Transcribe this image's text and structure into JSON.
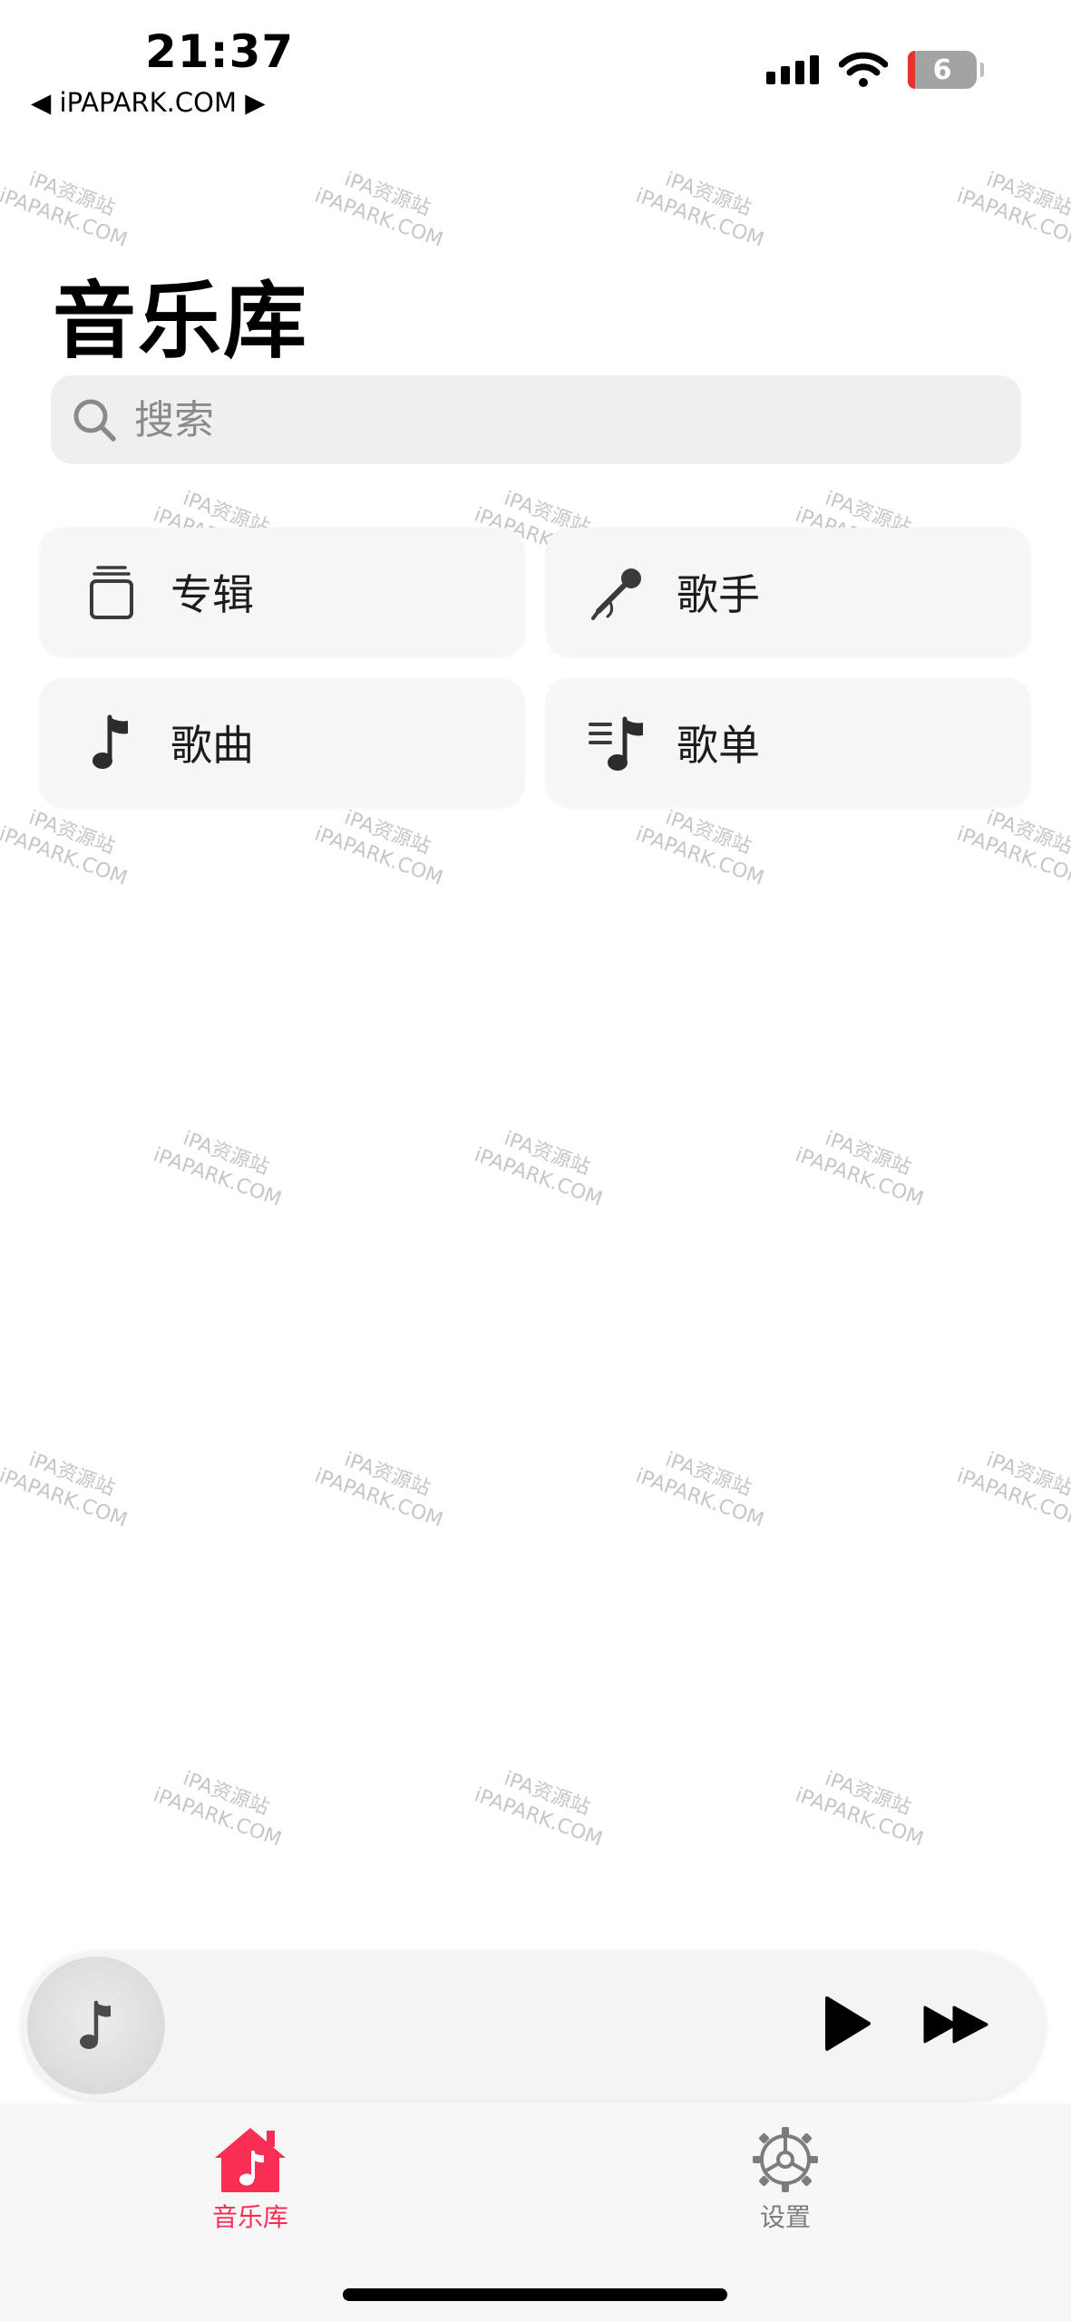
{
  "status_bar": {
    "time": "21:37",
    "back_label": "◀ iPAPARK.COM ▶",
    "battery_level": "6"
  },
  "page": {
    "title": "音乐库"
  },
  "search": {
    "placeholder": "搜索"
  },
  "categories": [
    {
      "label": "专辑",
      "icon": "album-stack-icon"
    },
    {
      "label": "歌手",
      "icon": "microphone-icon"
    },
    {
      "label": "歌曲",
      "icon": "music-note-icon"
    },
    {
      "label": "歌单",
      "icon": "playlist-icon"
    }
  ],
  "watermark": {
    "line1": "iPA资源站",
    "line2": "iPAPARK.COM"
  },
  "mini_player": {
    "artwork_icon": "music-note-icon",
    "play_icon": "play-icon",
    "next_icon": "forward-icon"
  },
  "tab_bar": {
    "tabs": [
      {
        "label": "音乐库",
        "icon": "home-music-icon",
        "active": true
      },
      {
        "label": "设置",
        "icon": "gear-icon",
        "active": false
      }
    ]
  },
  "colors": {
    "accent": "#fa2d55",
    "card_bg": "#f6f6f7",
    "search_bg": "#efeff1",
    "inactive": "#7b7b80"
  }
}
